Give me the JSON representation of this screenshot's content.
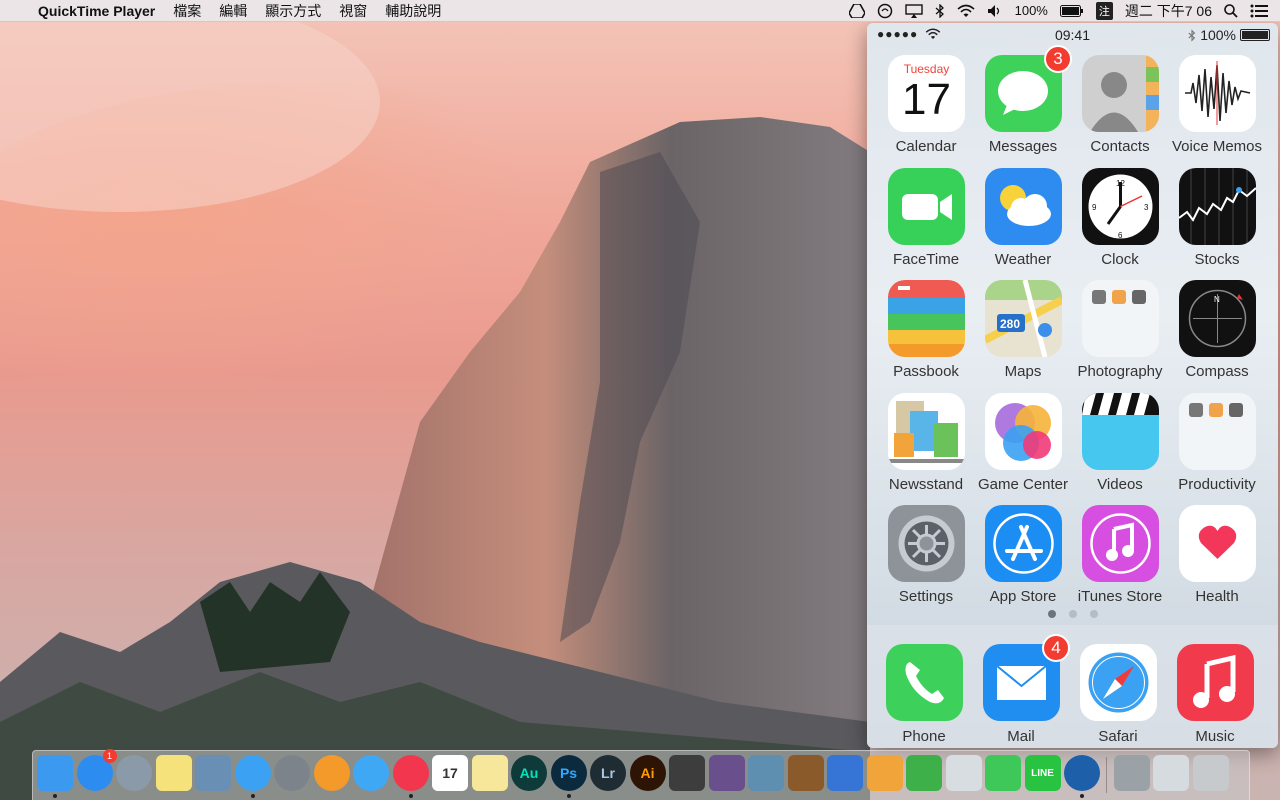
{
  "menubar": {
    "apple_glyph": "",
    "app_name": "QuickTime Player",
    "menus": [
      "檔案",
      "編輯",
      "顯示方式",
      "視窗",
      "輔助說明"
    ],
    "status": {
      "battery": "100%",
      "input_method": "注",
      "datetime": "週二 下午7 06"
    }
  },
  "iphone": {
    "status": {
      "signal": "●●●●●",
      "time": "09:41",
      "battery": "100%"
    },
    "calendar": {
      "weekday": "Tuesday",
      "day": "17"
    },
    "apps": [
      {
        "label": "Calendar",
        "icon": "calendar-icon",
        "color": "#ffffff"
      },
      {
        "label": "Messages",
        "icon": "messages-icon",
        "color": "#3fd25a",
        "badge": "3"
      },
      {
        "label": "Contacts",
        "icon": "contacts-icon",
        "color": "#c9c9c9"
      },
      {
        "label": "Voice Memos",
        "icon": "voice-memos-icon",
        "color": "#ffffff"
      },
      {
        "label": "FaceTime",
        "icon": "facetime-icon",
        "color": "#37d15a"
      },
      {
        "label": "Weather",
        "icon": "weather-icon",
        "color": "#2e8bef"
      },
      {
        "label": "Clock",
        "icon": "clock-icon",
        "color": "#111111"
      },
      {
        "label": "Stocks",
        "icon": "stocks-icon",
        "color": "#111111"
      },
      {
        "label": "Passbook",
        "icon": "passbook-icon",
        "color": "#3aa3e6"
      },
      {
        "label": "Maps",
        "icon": "maps-icon",
        "color": "#e8e2d0"
      },
      {
        "label": "Photography",
        "icon": "folder-icon",
        "color": "#f2f5f7"
      },
      {
        "label": "Compass",
        "icon": "compass-icon",
        "color": "#111111"
      },
      {
        "label": "Newsstand",
        "icon": "newsstand-icon",
        "color": "#ffffff"
      },
      {
        "label": "Game Center",
        "icon": "game-center-icon",
        "color": "#ffffff"
      },
      {
        "label": "Videos",
        "icon": "videos-icon",
        "color": "#46c7ef"
      },
      {
        "label": "Productivity",
        "icon": "folder-icon",
        "color": "#f2f5f7"
      },
      {
        "label": "Settings",
        "icon": "settings-icon",
        "color": "#8e939a"
      },
      {
        "label": "App Store",
        "icon": "app-store-icon",
        "color": "#1c8ef3"
      },
      {
        "label": "iTunes Store",
        "icon": "itunes-store-icon",
        "color": "#d64fe0"
      },
      {
        "label": "Health",
        "icon": "health-icon",
        "color": "#ffffff"
      }
    ],
    "dock": [
      {
        "label": "Phone",
        "icon": "phone-icon",
        "color": "#3dd05a"
      },
      {
        "label": "Mail",
        "icon": "mail-icon",
        "color": "#1f8ef0",
        "badge": "4"
      },
      {
        "label": "Safari",
        "icon": "safari-icon",
        "color": "#ffffff"
      },
      {
        "label": "Music",
        "icon": "music-icon",
        "color": "#f23a4d"
      }
    ]
  },
  "mac_dock": {
    "items": [
      {
        "name": "finder-icon",
        "color": "#3b9af0",
        "text": "",
        "running": true
      },
      {
        "name": "app-store-icon",
        "color": "#2d8cf0",
        "text": "",
        "badge": "1"
      },
      {
        "name": "launchpad-icon",
        "color": "#8a9aa8",
        "text": ""
      },
      {
        "name": "stickies-icon",
        "color": "#f5e27a",
        "text": ""
      },
      {
        "name": "preview-icon",
        "color": "#6a8fb5",
        "text": ""
      },
      {
        "name": "safari-icon",
        "color": "#3ba1f2",
        "text": "",
        "running": true
      },
      {
        "name": "system-preferences-icon",
        "color": "#7d838a",
        "text": ""
      },
      {
        "name": "ibooks-icon",
        "color": "#f39a2a",
        "text": ""
      },
      {
        "name": "messages-icon",
        "color": "#3fa8f5",
        "text": ""
      },
      {
        "name": "itunes-icon",
        "color": "#f2364d",
        "text": "",
        "running": true
      },
      {
        "name": "calendar-icon",
        "color": "#ffffff",
        "text": "17"
      },
      {
        "name": "notes-icon",
        "color": "#f7e79a",
        "text": ""
      },
      {
        "name": "audition-icon",
        "color": "#0e3b3a",
        "text": "Au"
      },
      {
        "name": "photoshop-icon",
        "color": "#0c2a3e",
        "text": "Ps",
        "running": true
      },
      {
        "name": "lightroom-icon",
        "color": "#1f2c33",
        "text": "Lr"
      },
      {
        "name": "illustrator-icon",
        "color": "#2e1405",
        "text": "Ai"
      },
      {
        "name": "final-cut-icon",
        "color": "#3d3d3d",
        "text": ""
      },
      {
        "name": "motion-icon",
        "color": "#6a4f8d",
        "text": ""
      },
      {
        "name": "iphoto-icon",
        "color": "#5e8fb0",
        "text": ""
      },
      {
        "name": "garageband-icon",
        "color": "#8b5a2b",
        "text": ""
      },
      {
        "name": "keynote-icon",
        "color": "#3675d6",
        "text": ""
      },
      {
        "name": "pages-icon",
        "color": "#f0a43a",
        "text": ""
      },
      {
        "name": "numbers-icon",
        "color": "#3db04a",
        "text": ""
      },
      {
        "name": "preview-photos-icon",
        "color": "#d8dde2",
        "text": ""
      },
      {
        "name": "facetime-icon",
        "color": "#3fc85a",
        "text": ""
      },
      {
        "name": "line-icon",
        "color": "#28c340",
        "text": "LINE"
      },
      {
        "name": "quicktime-icon",
        "color": "#1d5fa8",
        "text": "",
        "running": true
      },
      {
        "name": "photo-slideshow-icon",
        "color": "#9aa2a8",
        "text": ""
      },
      {
        "name": "downloads-icon",
        "color": "#d6dbe0",
        "text": ""
      },
      {
        "name": "trash-icon",
        "color": "#c6cacd",
        "text": ""
      }
    ]
  }
}
